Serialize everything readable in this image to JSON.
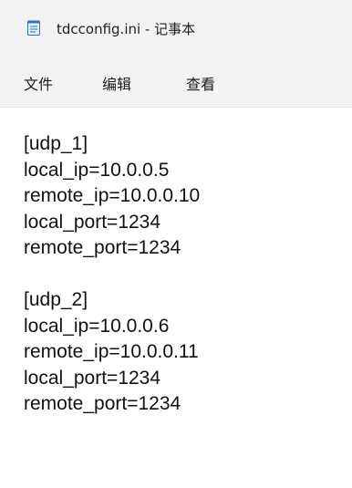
{
  "window": {
    "title": "tdcconfig.ini - 记事本",
    "icon": "notepad-icon"
  },
  "menu": {
    "file": "文件",
    "edit": "编辑",
    "view": "查看"
  },
  "document": {
    "lines": [
      "[udp_1]",
      "local_ip=10.0.0.5",
      "remote_ip=10.0.0.10",
      "local_port=1234",
      "remote_port=1234",
      "",
      "[udp_2]",
      "local_ip=10.0.0.6",
      "remote_ip=10.0.0.11",
      "local_port=1234",
      "remote_port=1234"
    ]
  },
  "colors": {
    "chrome_background": "#f3f3f3",
    "editor_background": "#ffffff",
    "icon_accent": "#2f6fd1"
  }
}
